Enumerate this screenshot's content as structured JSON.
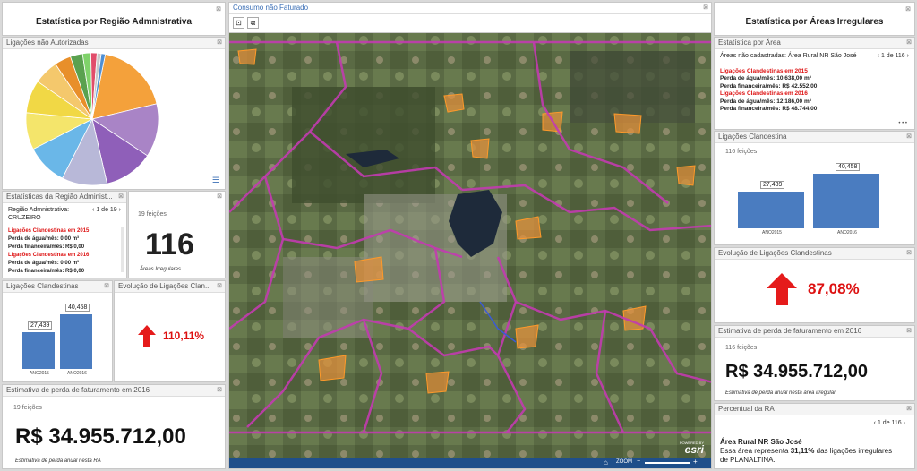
{
  "left": {
    "title": "Estatística por Região Admnistrativa",
    "pie_header": "Ligações não Autorizadas",
    "stats_header": "Estatísticas da Região Administ...",
    "region_label": "Região Admnistrativa:",
    "region_value": "CRUZEIRO",
    "pager": "1 de 19",
    "l2015": "Ligações Clandestinas em 2015",
    "water2015": "Perda de água/mês: 0,00 m³",
    "fin2015": "Perda financeira/mês: R$ 0,00",
    "l2016": "Ligações Clandestinas em 2016",
    "water2016": "Perda de água/mês: 0,00 m³",
    "fin2016": "Perda financeira/mês: R$ 0,00",
    "count_label": "19 feições",
    "count_value": "116",
    "count_caption": "Áreas Irregulares",
    "lig_header": "Ligações Clandestinas",
    "evol_header": "Evolução de Ligações Clan...",
    "evol_value": "110,11%",
    "est_header": "Estimativa de perda de faturamento em 2016",
    "est_count": "19 feições",
    "est_value": "R$ 34.955.712,00",
    "est_caption": "Estimativa de perda anual nesta RA"
  },
  "map": {
    "header": "Consumo não Faturado",
    "zoom_label": "ZOOM",
    "esri_powered": "POWERED BY",
    "esri": "esri"
  },
  "right": {
    "title": "Estatística por Áreas Irregulares",
    "area_header": "Estatística por Área",
    "area_label": "Áreas não cadastradas: Área Rural NR São José",
    "pager": "1 de 116",
    "l2015": "Ligações Clandestinas em 2015",
    "water2015": "Perda de água/mês: 10.638,00 m³",
    "fin2015": "Perda financeira/mês: R$ 42.552,00",
    "l2016": "Ligações Clandestinas em 2016",
    "water2016": "Perda de água/mês: 12.186,00 m³",
    "fin2016": "Perda financeira/mês: R$ 48.744,00",
    "more": "• • •",
    "lig_header": "Ligações Clandestina",
    "lig_count": "116 feições",
    "evol_header": "Evolução de Ligações Clandestinas",
    "evol_value": "87,08%",
    "est_header": "Estimativa de perda de faturamento em 2016",
    "est_count": "116 feições",
    "est_value": "R$ 34.955.712,00",
    "est_caption": "Estimativa de perda anual nesta área irregular",
    "pct_header": "Percentual da RA",
    "pct_pager": "1 de 116",
    "pct_name": "Área Rural NR São José",
    "pct_text1": "Essa área representa ",
    "pct_value": "31,11%",
    "pct_text2": " das ligações irregulares",
    "pct_text3": "de PLANALTINA."
  },
  "chart_data": [
    {
      "type": "pie",
      "title": "",
      "values": [
        18,
        13,
        12,
        11,
        10,
        9,
        8,
        6,
        4,
        3,
        2,
        1.5,
        1,
        1
      ],
      "colors": [
        "#f4a13b",
        "#a984c6",
        "#8f5fb9",
        "#b8b8d8",
        "#6ab7e8",
        "#f4e56b",
        "#f1d845",
        "#f4c86c",
        "#e88f2a",
        "#5aa14f",
        "#7fd26a",
        "#e14d6b",
        "#c9c9c9",
        "#4f8fd3"
      ]
    },
    {
      "type": "bar",
      "categories": [
        "ANO2015",
        "ANO2016"
      ],
      "values": [
        27439,
        40458
      ],
      "labels": [
        "27,439",
        "40,458"
      ]
    },
    {
      "type": "bar",
      "categories": [
        "ANO2015",
        "ANO2016"
      ],
      "values": [
        27439,
        40458
      ],
      "labels": [
        "27,439",
        "40,458"
      ]
    }
  ]
}
